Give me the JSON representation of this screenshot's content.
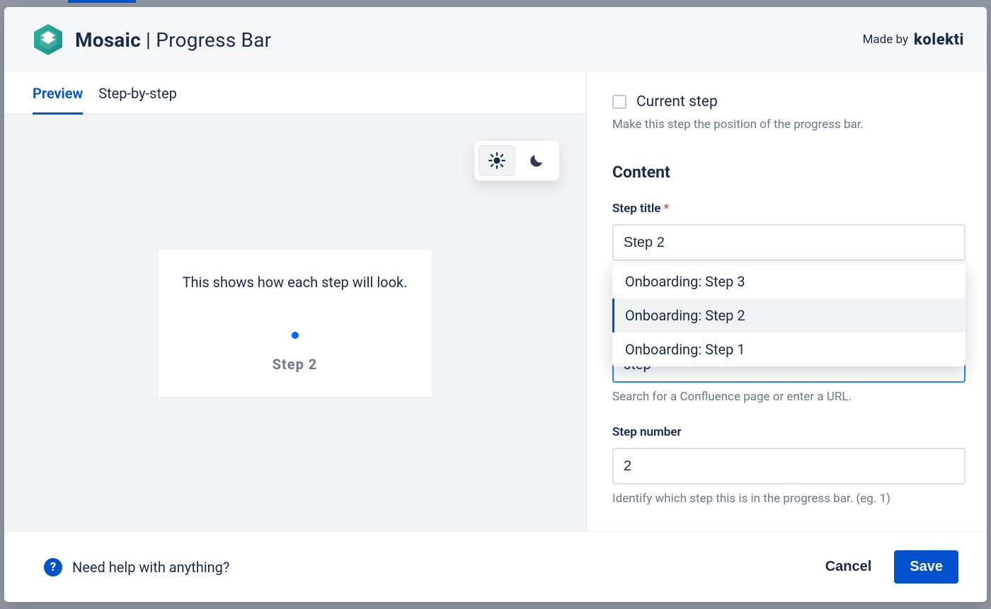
{
  "header": {
    "brand_bold": "Mosaic",
    "brand_sep": "|",
    "brand_rest": "Progress Bar",
    "made_by": "Made by",
    "company": "kolekti"
  },
  "tabs": {
    "preview": "Preview",
    "step_by_step": "Step-by-step"
  },
  "preview": {
    "description": "This shows how each step will look.",
    "step_label": "Step 2"
  },
  "right": {
    "current_step_label": "Current step",
    "current_step_helper": "Make this step the position of the progress bar.",
    "content_heading": "Content",
    "step_title_label": "Step title",
    "step_title_value": "Step 2",
    "dropdown_options": [
      "Onboarding: Step 3",
      "Onboarding: Step 2",
      "Onboarding: Step 1"
    ],
    "destination_value": "step",
    "destination_helper": "Search for a Confluence page or enter a URL.",
    "step_number_label": "Step number",
    "step_number_value": "2",
    "step_number_helper": "Identify which step this is in the progress bar. (eg. 1)"
  },
  "footer": {
    "help_text": "Need help with anything?",
    "cancel": "Cancel",
    "save": "Save"
  }
}
